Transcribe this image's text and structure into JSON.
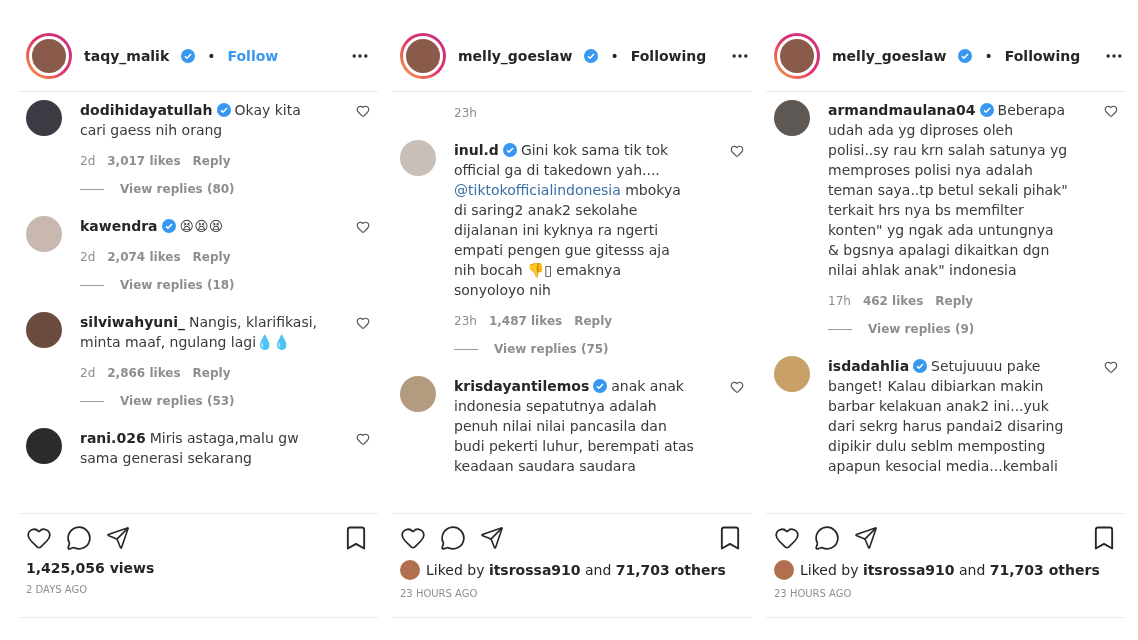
{
  "posts": [
    {
      "header": {
        "username": "taqy_malik",
        "verified": true,
        "separator": "•",
        "follow_label": "Follow",
        "following": false
      },
      "comments": [
        {
          "username": "dodihidayatullah",
          "verified": true,
          "text": [
            {
              "kind": "plain",
              "text": "Okay kita cari gaess nih orang"
            }
          ],
          "time": "2d",
          "likes": "3,017 likes",
          "reply": "Reply",
          "view_replies": "View replies (80)"
        },
        {
          "username": "kawendra",
          "verified": true,
          "text": [
            {
              "kind": "plain",
              "text": "😫😫😫"
            }
          ],
          "time": "2d",
          "likes": "2,074 likes",
          "reply": "Reply",
          "view_replies": "View replies (18)"
        },
        {
          "username": "silviwahyuni_",
          "verified": false,
          "text": [
            {
              "kind": "plain",
              "text": "Nangis, klarifikasi, minta maaf, ngulang lagi💧💧"
            }
          ],
          "time": "2d",
          "likes": "2,866 likes",
          "reply": "Reply",
          "view_replies": "View replies (53)"
        },
        {
          "username": "rani.026",
          "verified": false,
          "text": [
            {
              "kind": "plain",
              "text": "Miris astaga,malu gw sama generasi sekarang"
            }
          ]
        }
      ],
      "footer": {
        "kind": "views",
        "text": "1,425,056 views",
        "time": "2 DAYS AGO"
      }
    },
    {
      "header": {
        "username": "melly_goeslaw",
        "verified": true,
        "separator": "•",
        "follow_label": "Following",
        "following": true
      },
      "top_time": "23h",
      "comments": [
        {
          "username": "inul.d",
          "verified": true,
          "text": [
            {
              "kind": "plain",
              "text": "Gini kok sama tik tok official ga di takedown yah.... "
            },
            {
              "kind": "mention",
              "text": "@tiktokofficialindonesia"
            },
            {
              "kind": "plain",
              "text": " mbokya di saring2 anak2 sekolahe dijalanan ini kyknya ra ngerti empati pengen gue gitesss aja nih bocah 👎▯ emaknya sonyoloyo nih"
            }
          ],
          "time": "23h",
          "likes": "1,487 likes",
          "reply": "Reply",
          "view_replies": "View replies (75)"
        },
        {
          "username": "krisdayantilemos",
          "verified": true,
          "text": [
            {
              "kind": "plain",
              "text": "anak anak indonesia sepatutnya adalah penuh nilai nilai pancasila dan budi pekerti luhur, berempati atas keadaan saudara saudara"
            }
          ]
        }
      ],
      "footer": {
        "kind": "likes",
        "text": "Liked by **itsrossa910** and **71,703 others**",
        "time": "23 HOURS AGO"
      }
    },
    {
      "header": {
        "username": "melly_goeslaw",
        "verified": true,
        "separator": "•",
        "follow_label": "Following",
        "following": true
      },
      "comments": [
        {
          "username": "armandmaulana04",
          "verified": true,
          "text": [
            {
              "kind": "plain",
              "text": "Beberapa udah ada yg diproses oleh polisi..sy rau krn salah satunya yg memproses polisi nya adalah teman saya..tp betul sekali pihak\" terkait hrs nya bs memfilter konten\" yg ngak ada untungnya & bgsnya apalagi dikaitkan dgn nilai ahlak anak\" indonesia"
            }
          ],
          "time": "17h",
          "likes": "462 likes",
          "reply": "Reply",
          "view_replies": "View replies (9)"
        },
        {
          "username": "isdadahlia",
          "verified": true,
          "text": [
            {
              "kind": "plain",
              "text": "Setujuuuu pake banget! Kalau dibiarkan makin barbar kelakuan anak2 ini...yuk dari sekrg harus pandai2 disaring dipikir dulu seblm memposting apapun kesocial media...kembali"
            }
          ]
        }
      ],
      "footer": {
        "kind": "likes",
        "text": "Liked by **itsrossa910** and **71,703 others**",
        "time": "23 HOURS AGO"
      }
    }
  ]
}
